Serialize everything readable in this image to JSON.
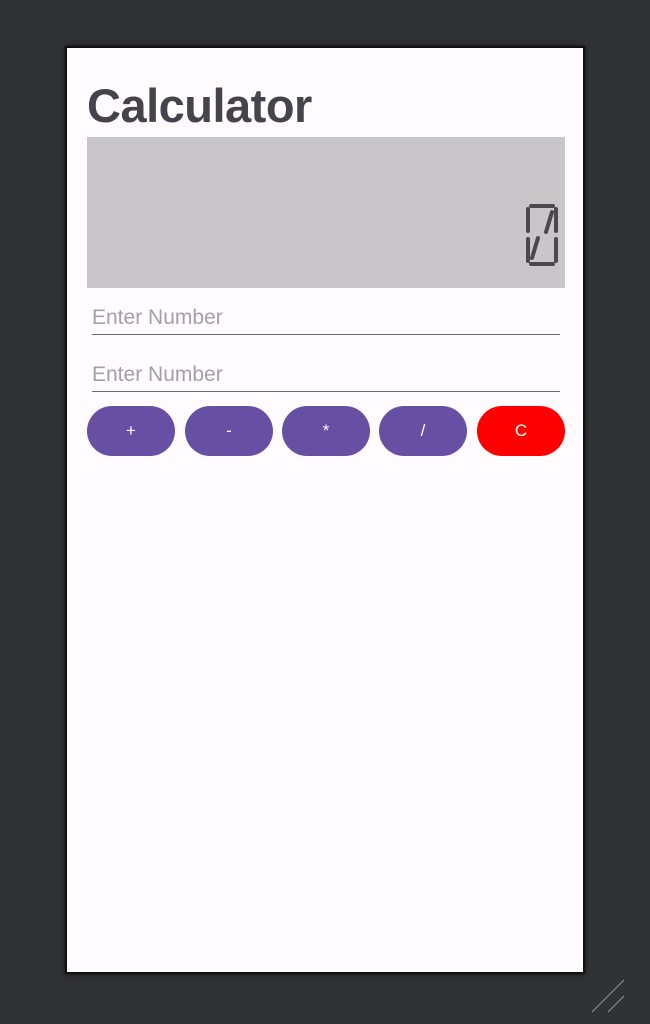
{
  "app": {
    "title": "Calculator"
  },
  "display": {
    "value": "0"
  },
  "inputs": [
    {
      "value": "",
      "placeholder": "Enter Number"
    },
    {
      "value": "",
      "placeholder": "Enter Number"
    }
  ],
  "buttons": [
    {
      "label": "+"
    },
    {
      "label": "-"
    },
    {
      "label": "*"
    },
    {
      "label": "/"
    },
    {
      "label": "C"
    }
  ],
  "colors": {
    "accent": "#6750a4",
    "clear": "#ff0000",
    "display_bg": "#c8c6c9",
    "title": "#45434b"
  }
}
